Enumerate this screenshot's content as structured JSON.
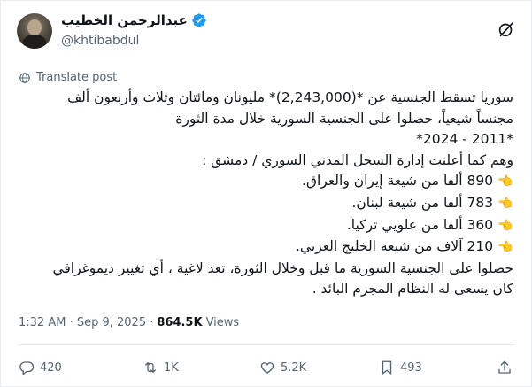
{
  "author": {
    "display_name": "عبدالرحمن الخطيب",
    "handle": "@khtibabdul"
  },
  "translate_label": "Translate post",
  "post_lines": [
    "سوريا تسقط الجنسية عن *(2,243,000)* مليونان ومائتان وثلاث وأربعون ألف",
    "مجنساً شيعياً، حصلوا على الجنسية السورية خلال مدة الثورة",
    "*2011 - 2024*",
    "وهم كما أعلنت إدارة السجل المدني السوري / دمشق :",
    "890 ألفا من شيعة إيران والعراق.",
    "783 ألفا من شيعة لبنان.",
    "360 ألفا من علويي تركيا.",
    "210 آلاف من شيعة الخليج العربي.",
    "حصلوا على الجنسية السورية ما قبل وخلال الثورة، تعد لاغية ، أي تغيير ديموغرافي",
    "كان يسعى له النظام المجرم البائد ."
  ],
  "pointer_emoji": "👈",
  "timestamp": "1:32 AM · Sep 9, 2025 ·",
  "views_count": "864.5K",
  "views_label": "Views",
  "actions": {
    "replies": "420",
    "reposts": "1K",
    "likes": "5.2K",
    "bookmarks": "493"
  },
  "colors": {
    "verified_blue": "#1d9bf0",
    "secondary_text": "#536471",
    "primary_text": "#0f1419"
  },
  "icons": [
    "verified-badge-icon",
    "grok-icon",
    "globe-icon",
    "reply-icon",
    "repost-icon",
    "like-icon",
    "bookmark-icon",
    "share-icon"
  ]
}
